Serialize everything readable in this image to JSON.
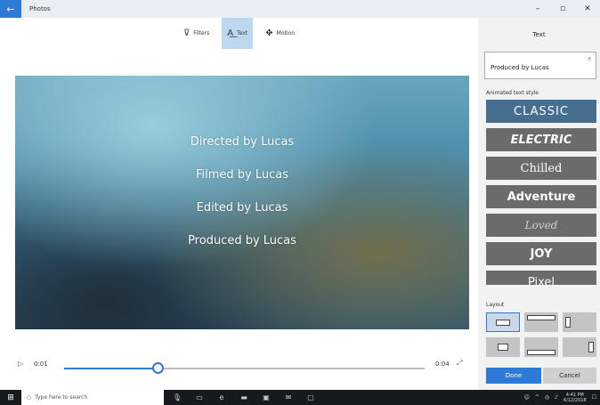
{
  "window": {
    "title": "Photos"
  },
  "toolbar": {
    "items": [
      {
        "label": "Filters",
        "icon": "filters-icon"
      },
      {
        "label": "Text",
        "icon": "text-icon"
      },
      {
        "label": "Motion",
        "icon": "motion-icon"
      }
    ],
    "active": "Text"
  },
  "video": {
    "credits": [
      "Directed by Lucas",
      "Filmed by Lucas",
      "Edited by Lucas",
      "Produced by Lucas"
    ]
  },
  "player": {
    "current_time": "0:01",
    "end_time": "0:04",
    "progress": 0.26
  },
  "panel": {
    "title": "Text",
    "text_value": "Produced by Lucas",
    "style_label": "Animated text style",
    "styles": [
      "CLASSIC",
      "ELECTRIC",
      "Chilled",
      "Adventure",
      "Loved",
      "JOY",
      "Pixel"
    ],
    "selected_style": "CLASSIC",
    "layout_label": "Layout",
    "done_label": "Done",
    "cancel_label": "Cancel"
  },
  "taskbar": {
    "search_placeholder": "Type here to search",
    "time": "4:41 PM",
    "date": "6/12/2018"
  },
  "colors": {
    "accent": "#2e7bd6",
    "selected_style": "#466e8e"
  }
}
